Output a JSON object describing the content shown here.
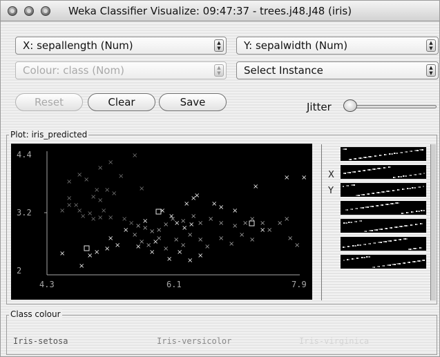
{
  "window": {
    "title": "Weka Classifier Visualize: 09:47:37 - trees.j48.J48 (iris)"
  },
  "controls": {
    "x_axis_select": "X: sepallength (Num)",
    "y_axis_select": "Y: sepalwidth (Num)",
    "colour_select": "Colour: class (Nom)",
    "instance_select": "Select Instance",
    "reset_label": "Reset",
    "clear_label": "Clear",
    "save_label": "Save",
    "jitter_label": "Jitter",
    "jitter_level": 0
  },
  "plot": {
    "group_label": "Plot: iris_predicted",
    "side_x_label": "X",
    "side_y_label": "Y",
    "axis": {
      "x_min_label": "4.3",
      "x_mid_label": "6.1",
      "x_max_label": "7.9",
      "y_max_label": "4.4",
      "y_mid_label": "3.2",
      "y_min_label": "2"
    },
    "colors": {
      "background": "#000000",
      "setosa": "#6e6e6e",
      "versicolor": "#9a9a9a",
      "virginica": "#e6e6e6",
      "axes": "#a8a8a8"
    }
  },
  "class_colour": {
    "group_label": "Class colour",
    "classes": [
      "Iris-setosa",
      "Iris-versicolor",
      "Iris-virginica"
    ],
    "colors": [
      "#555555",
      "#888888",
      "#d4d4d4"
    ]
  }
}
